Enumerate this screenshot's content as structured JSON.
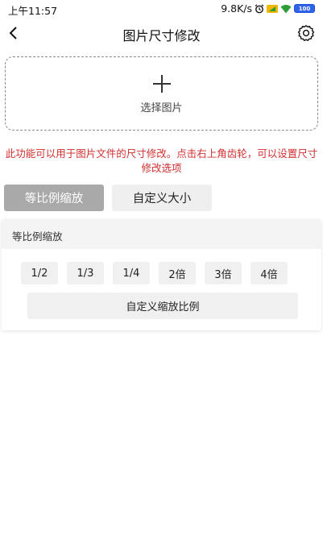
{
  "status_bar": {
    "time": "上午11:57",
    "speed": "9.8K/s",
    "battery": "100"
  },
  "header": {
    "title": "图片尺寸修改"
  },
  "picker": {
    "label": "选择图片"
  },
  "notice": {
    "text": "此功能可以用于图片文件的尺寸修改。点击右上角齿轮，可以设置尺寸修改选项"
  },
  "tabs": [
    {
      "label": "等比例缩放",
      "active": true
    },
    {
      "label": "自定义大小",
      "active": false
    }
  ],
  "scale_panel": {
    "title": "等比例缩放",
    "ratios": [
      "1/2",
      "1/3",
      "1/4",
      "2倍",
      "3倍",
      "4倍"
    ],
    "custom_label": "自定义缩放比例"
  },
  "colors": {
    "notice": "#d32f2f",
    "active_tab": "#a9a9a9",
    "button_bg": "#f0f0f0"
  }
}
